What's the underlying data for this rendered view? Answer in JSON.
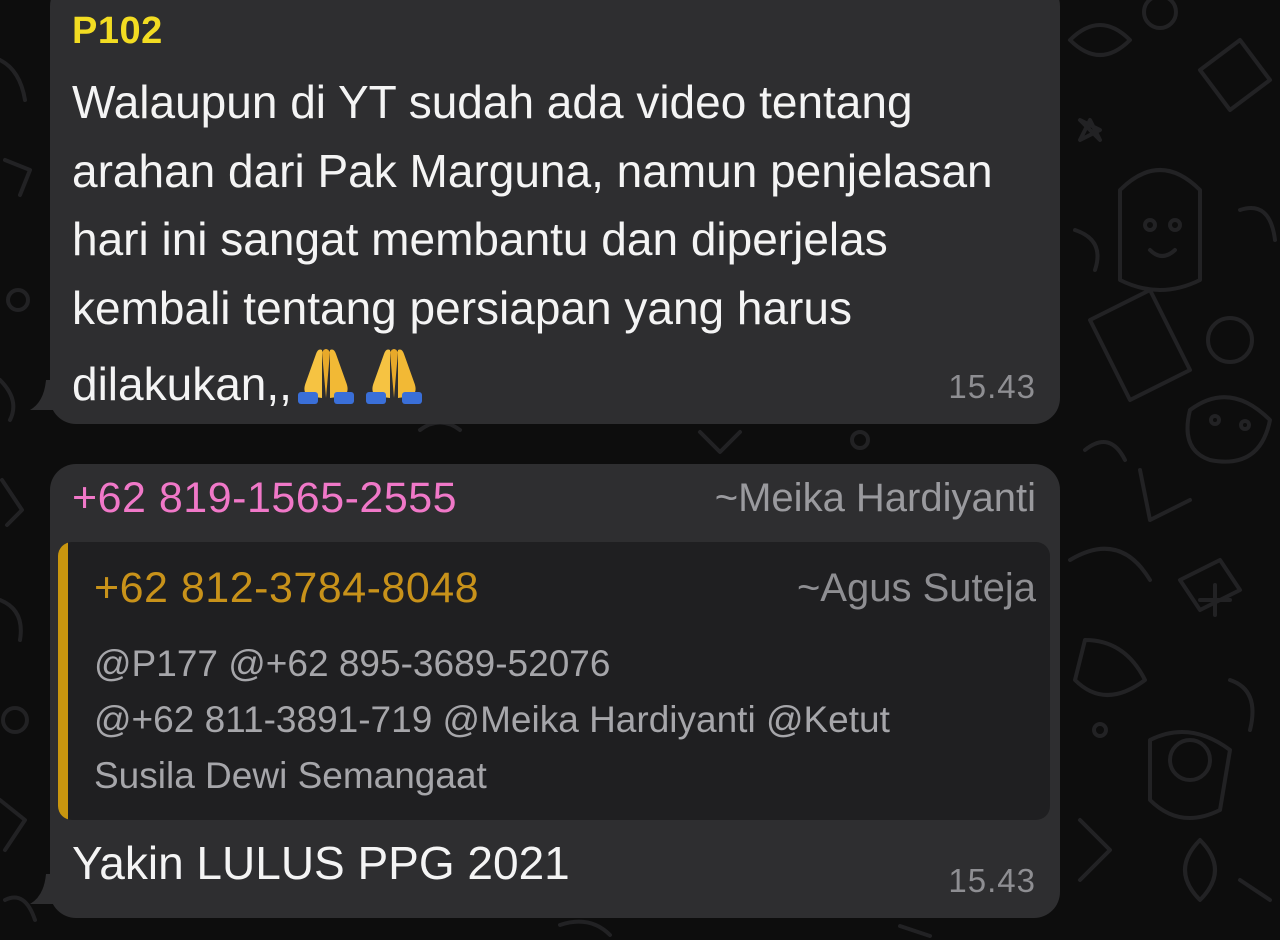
{
  "theme": {
    "background": "#0d0d0d",
    "bubble": "#2e2e30",
    "sender_p102_color": "#f2dc22",
    "sender_phone_color": "#f078c8",
    "quote_accent": "#c9960f"
  },
  "messages": [
    {
      "sender": "P102",
      "text": "Walaupun di YT sudah ada video tentang arahan dari Pak Marguna, namun penjelasan hari ini sangat membantu dan diperjelas kembali tentang persiapan yang harus dilakukan,,",
      "emojis": [
        "folded-hands-icon",
        "folded-hands-icon"
      ],
      "time": "15.43"
    },
    {
      "sender_phone": "+62 819-1565-2555",
      "sender_name": "~Meika Hardiyanti",
      "quoted": {
        "sender_phone": "+62 812-3784-8048",
        "sender_name": "~Agus Suteja",
        "text_line1": "@P177 @+62 895-3689-52076",
        "text_line2": "@+62 811-3891-719 @Meika Hardiyanti @Ketut",
        "text_line3": "Susila Dewi Semangaat"
      },
      "text": "Yakin LULUS PPG 2021",
      "time": "15.43"
    }
  ]
}
